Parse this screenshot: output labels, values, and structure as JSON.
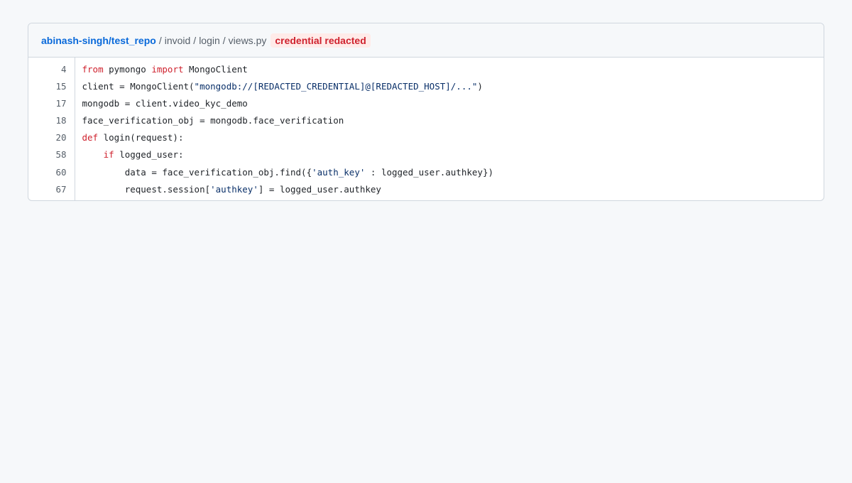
{
  "header": {
    "repo": "abinash-singh/test_repo",
    "path": [
      "invoid",
      "login",
      "views.py"
    ],
    "separator": "/",
    "badge": "credential redacted"
  },
  "colors": {
    "link": "#0969da",
    "keyword": "#cf222e",
    "string": "#0a3069",
    "badge_bg": "#ffebe9",
    "badge_fg": "#cf222e"
  },
  "lines": [
    {
      "num": "4",
      "tokens": [
        {
          "t": "from",
          "k": "kw"
        },
        {
          "t": " pymongo "
        },
        {
          "t": "import",
          "k": "kw"
        },
        {
          "t": " MongoClient"
        }
      ]
    },
    {
      "num": "15",
      "tokens": [
        {
          "t": "client = MongoClient("
        },
        {
          "t": "\"mongodb://[REDACTED_CREDENTIAL]@[REDACTED_HOST]/...\"",
          "k": "str"
        },
        {
          "t": ")"
        }
      ]
    },
    {
      "num": "17",
      "tokens": [
        {
          "t": "mongodb = client.video_kyc_demo"
        }
      ]
    },
    {
      "num": "18",
      "tokens": [
        {
          "t": "face_verification_obj = mongodb.face_verification"
        }
      ]
    },
    {
      "num": "20",
      "tokens": [
        {
          "t": "def",
          "k": "kw"
        },
        {
          "t": " login(request):"
        }
      ]
    },
    {
      "num": "58",
      "tokens": [
        {
          "t": "    "
        },
        {
          "t": "if",
          "k": "kw"
        },
        {
          "t": " logged_user:"
        }
      ]
    },
    {
      "num": "60",
      "tokens": [
        {
          "t": "        data = face_verification_obj.find({"
        },
        {
          "t": "'auth_key'",
          "k": "str"
        },
        {
          "t": " : logged_user.authkey})"
        }
      ]
    },
    {
      "num": "67",
      "tokens": [
        {
          "t": "        request.session["
        },
        {
          "t": "'authkey'",
          "k": "str"
        },
        {
          "t": "] = logged_user.authkey"
        }
      ]
    }
  ]
}
